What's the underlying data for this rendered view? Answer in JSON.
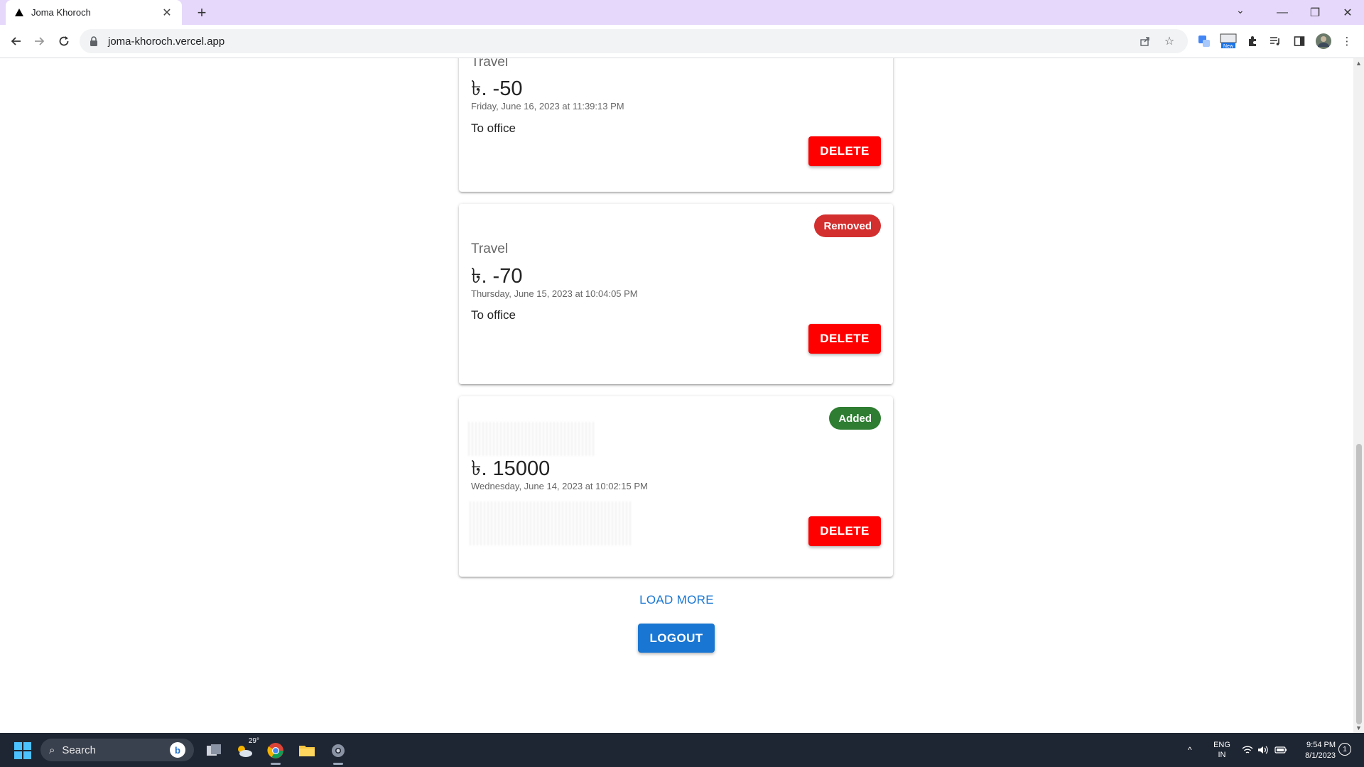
{
  "browser": {
    "tab_title": "Joma Khoroch",
    "url": "joma-khoroch.vercel.app",
    "new_tab_glyph": "+",
    "tab_close_glyph": "✕"
  },
  "transactions": [
    {
      "category": "Travel",
      "amount": "৳. -50",
      "datetime": "Friday, June 16, 2023 at 11:39:13 PM",
      "note": "To office",
      "badge": "",
      "delete_label": "DELETE"
    },
    {
      "category": "Travel",
      "amount": "৳. -70",
      "datetime": "Thursday, June 15, 2023 at 10:04:05 PM",
      "note": "To office",
      "badge": "Removed",
      "delete_label": "DELETE"
    },
    {
      "category": "",
      "amount": "৳. 15000",
      "datetime": "Wednesday, June 14, 2023 at 10:02:15 PM",
      "note": "",
      "badge": "Added",
      "delete_label": "DELETE"
    }
  ],
  "actions": {
    "load_more": "LOAD MORE",
    "logout": "LOGOUT"
  },
  "taskbar": {
    "search_label": "Search",
    "weather_temp": "29°",
    "lang_line1": "ENG",
    "lang_line2": "IN",
    "time": "9:54 PM",
    "date": "8/1/2023",
    "notification_count": "1"
  },
  "colors": {
    "delete": "#ff0000",
    "removed_badge": "#d32f2f",
    "added_badge": "#2e7d32",
    "primary": "#1976d2",
    "titlebar": "#e6d8fb"
  }
}
